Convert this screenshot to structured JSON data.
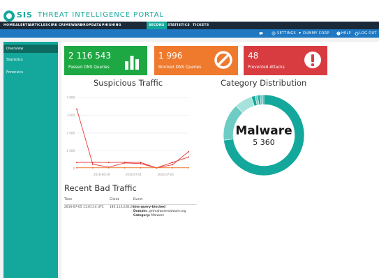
{
  "header": {
    "brand": "SIS",
    "title": "THREAT INTELLIGENCE PORTAL"
  },
  "nav": {
    "items": [
      {
        "label": "HOME"
      },
      {
        "label": "ALERTS"
      },
      {
        "label": "ARTICLES"
      },
      {
        "label": "CIRK"
      },
      {
        "label": "CRIMEWARE"
      },
      {
        "label": "DROPDATA"
      },
      {
        "label": "PHISHING"
      },
      {
        "label": "SECDNS",
        "active": true
      },
      {
        "label": "STATISTICS"
      },
      {
        "label": "TICKETS"
      }
    ]
  },
  "subbar": {
    "settings": "SETTINGS",
    "org": "DUMMY CORP",
    "help": "HELP",
    "logout": "LOG OUT"
  },
  "sidebar": {
    "items": [
      {
        "label": "Overview",
        "active": true
      },
      {
        "label": "Statistics"
      },
      {
        "label": "Forensics"
      }
    ]
  },
  "stats": [
    {
      "value": "2 116 543",
      "label": "Passed DNS Queries",
      "color": "#1ea844"
    },
    {
      "value": "1 996",
      "label": "Blocked DNS Queries",
      "color": "#ef7a2e"
    },
    {
      "value": "48",
      "label": "Prevented Attacks",
      "color": "#d93c40"
    }
  ],
  "traffic": {
    "title": "Suspicious Traffic",
    "chart_data": {
      "type": "line",
      "x": [
        "2016-06-22",
        "2016-06-25",
        "2016-06-27",
        "2016-06-29",
        "2016-07-01",
        "2016-07-03",
        "2016-07-05",
        "2016-07-07"
      ],
      "xticks": [
        "2016-06-29",
        "2016-07-01",
        "2016-07-03"
      ],
      "yticks": [
        "0",
        "1 000",
        "2 000",
        "3 000",
        "4 000"
      ],
      "ylim": [
        0,
        4000
      ],
      "series": [
        {
          "color": "#e53935",
          "values": [
            3350,
            250,
            80,
            320,
            280,
            40,
            220,
            950
          ]
        },
        {
          "color": "#e53935",
          "values": [
            350,
            350,
            350,
            350,
            350,
            40,
            350,
            650
          ]
        },
        {
          "color": "#ef7a2e",
          "values": [
            50,
            50,
            50,
            50,
            50,
            50,
            50,
            50
          ]
        }
      ]
    }
  },
  "category": {
    "title": "Category Distribution",
    "center_label": "Malware",
    "center_value": "5 360",
    "chart_data": {
      "type": "pie",
      "values": [
        73,
        15,
        7,
        1.5,
        1,
        1,
        1,
        0.5
      ],
      "colors": [
        "#14a89c",
        "#6dcdc5",
        "#a6e2dc",
        "#14a89c",
        "#6dcdc5",
        "#14a89c",
        "#6dcdc5",
        "#14a89c"
      ]
    }
  },
  "recent": {
    "title": "Recent Bad Traffic",
    "columns": [
      "Time",
      "Client",
      "Event"
    ],
    "rows": [
      {
        "time": "2016-07-05 11:01:14 UTC",
        "client": "185.113.228.20",
        "event": "dns-query-blocked",
        "domain_label": "Domain:",
        "domain": "getmalwaremalware.org",
        "category_label": "Category:",
        "category": "Malware"
      }
    ]
  }
}
